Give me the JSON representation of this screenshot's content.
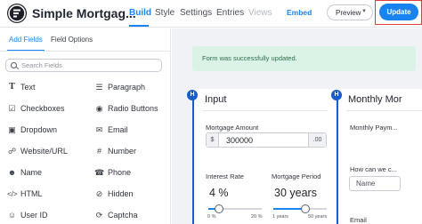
{
  "header": {
    "form_name": "Simple Mortgag...",
    "nav": {
      "build": "Build",
      "style": "Style",
      "settings": "Settings",
      "entries": "Entries",
      "views": "Views"
    },
    "embed_label": "Embed",
    "preview_label": "Preview",
    "update_label": "Update"
  },
  "sidebar": {
    "tabs": {
      "add_fields": "Add Fields",
      "field_options": "Field Options"
    },
    "search_placeholder": "Search Fields",
    "fields_left": [
      "Text",
      "Checkboxes",
      "Dropdown",
      "Website/URL",
      "Name",
      "HTML",
      "User ID"
    ],
    "fields_right": [
      "Paragraph",
      "Radio Buttons",
      "Email",
      "Number",
      "Phone",
      "Hidden",
      "Captcha"
    ],
    "icons_left": [
      "text-icon",
      "checkbox-icon",
      "dropdown-icon",
      "link-icon",
      "user-icon",
      "code-icon",
      "user-id-icon"
    ],
    "icons_right": [
      "paragraph-icon",
      "radio-icon",
      "email-icon",
      "number-icon",
      "phone-icon",
      "hidden-icon",
      "captcha-icon"
    ]
  },
  "canvas": {
    "success_message": "Form was successfully updated.",
    "input_section": {
      "badge": "H",
      "title": "Input",
      "mortgage_amount": {
        "label": "Mortgage Amount",
        "prefix": "$",
        "value": "300000",
        "suffix": ".00"
      },
      "interest_rate": {
        "label": "Interest Rate",
        "display": "4 %",
        "min_label": "0 %",
        "max_label": "20 %",
        "level": 0.2
      },
      "mortgage_period": {
        "label": "Mortgage Period",
        "display": "30 years",
        "min_label": "1 years",
        "max_label": "50 years",
        "level": 0.6
      }
    },
    "monthly_section": {
      "badge": "H",
      "title": "Monthly Mor",
      "monthly_payment_label": "Monthly Paym...",
      "question_label": "How can we c...",
      "name_placeholder": "Name",
      "email_label": "Email"
    }
  },
  "colors": {
    "accent": "#1a83f2",
    "section_badge": "#1a5cc9",
    "success_bg": "#daf3e6",
    "highlight_outline": "#e23b3b"
  }
}
